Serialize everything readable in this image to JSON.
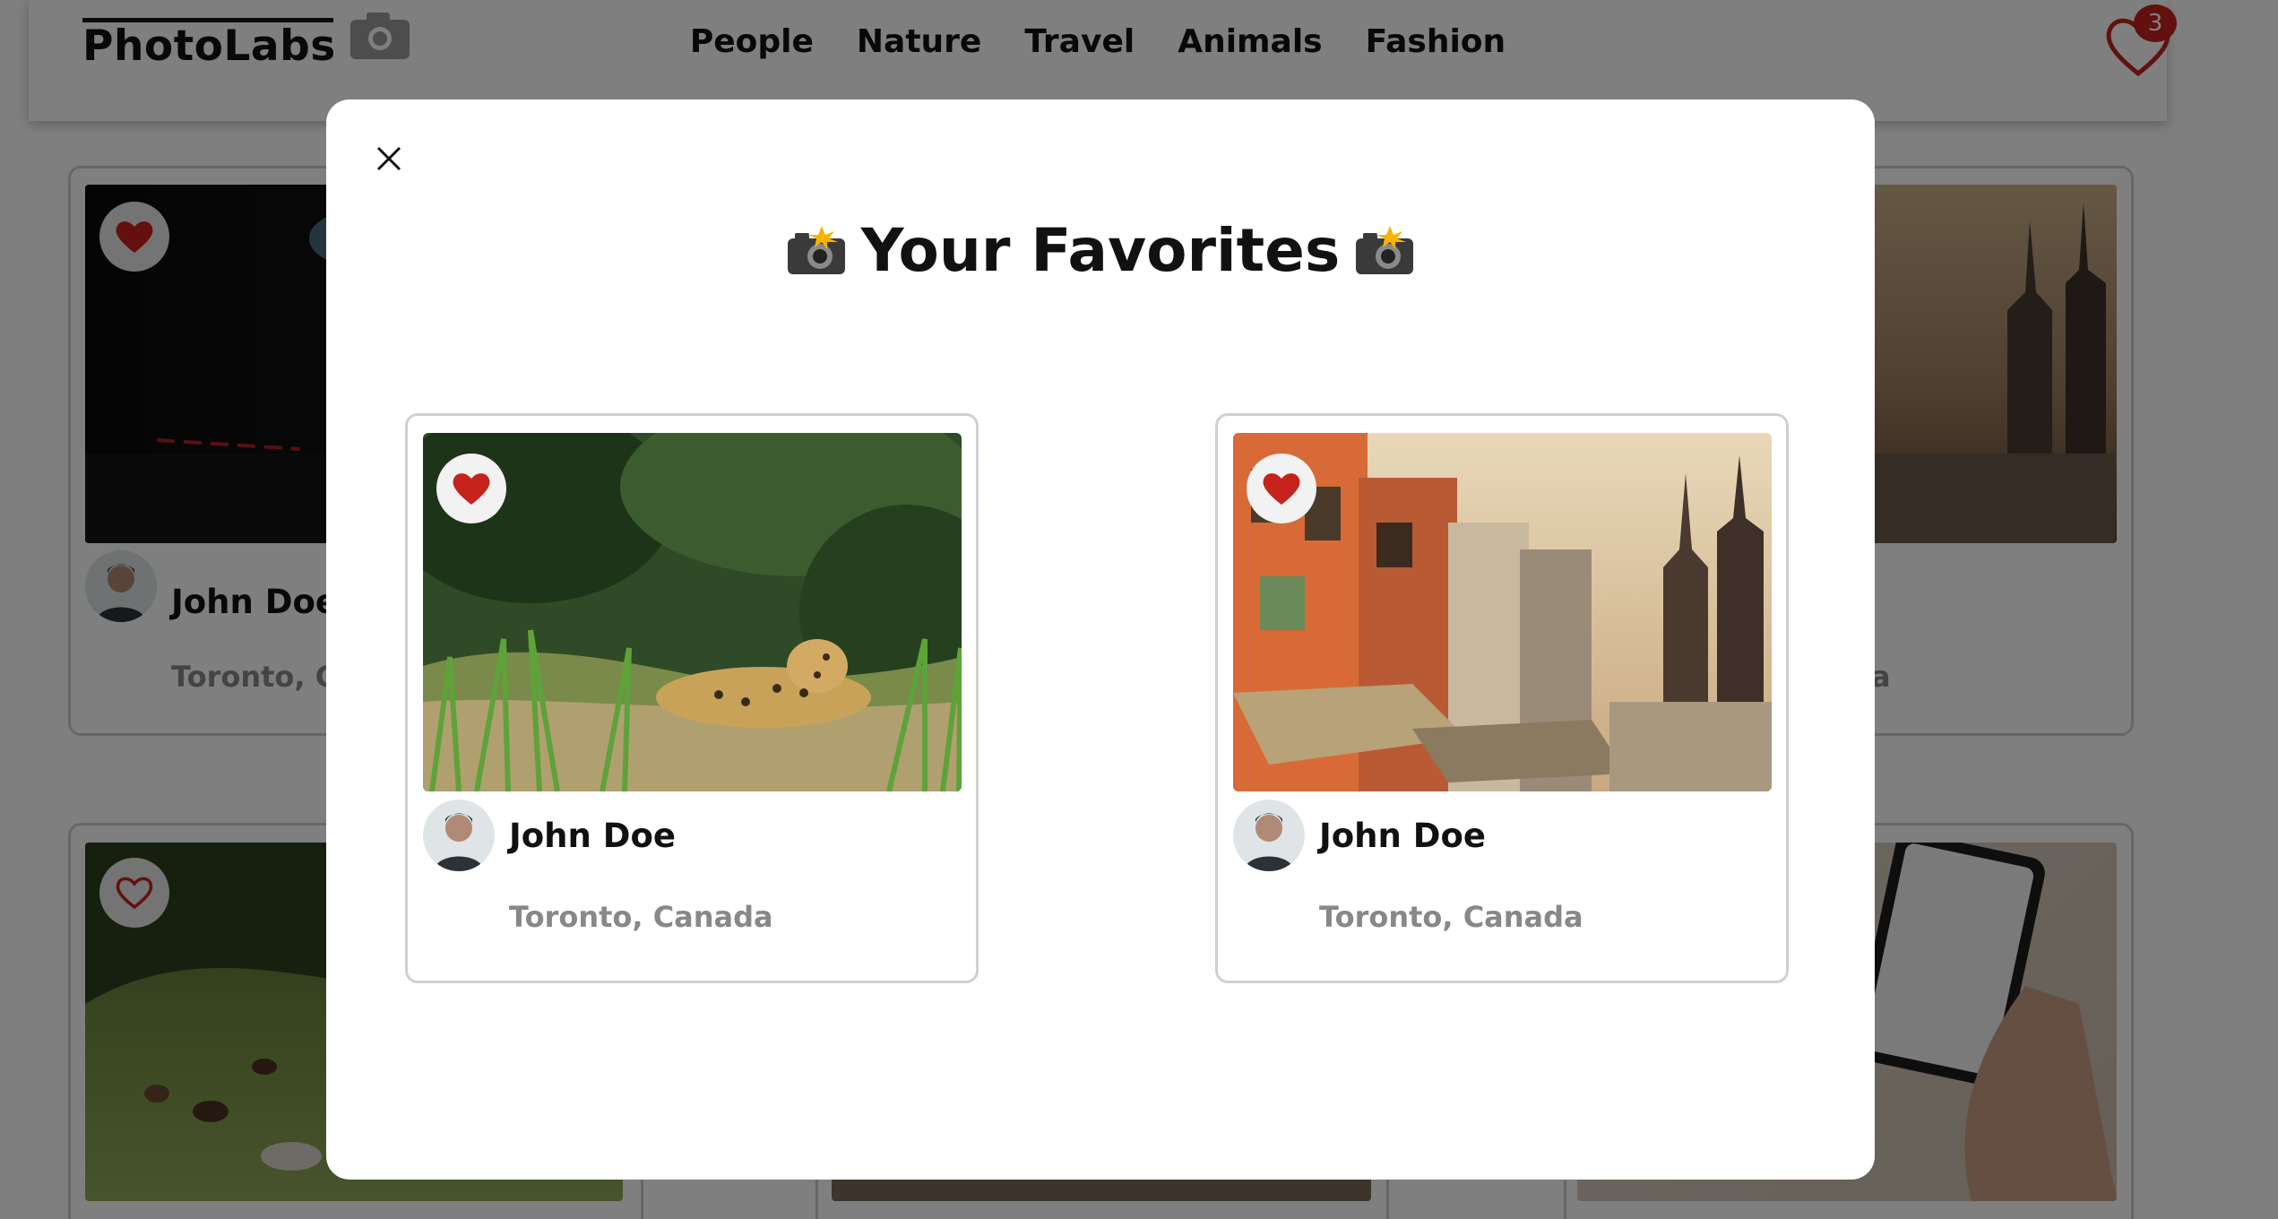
{
  "app": {
    "logo": "PhotoLabs"
  },
  "nav": {
    "topics": [
      "People",
      "Nature",
      "Travel",
      "Animals",
      "Fashion"
    ],
    "favorites_count": "3"
  },
  "background_cards": [
    {
      "name": "John Doe",
      "location": "Toronto, Ca",
      "liked": true
    },
    {
      "location_tail": "a",
      "liked": false
    },
    {
      "liked": false
    }
  ],
  "modal": {
    "title": "Your Favorites",
    "favorites": [
      {
        "name": "John Doe",
        "location": "Toronto, Canada",
        "liked": true,
        "photo": "jaguar-in-grass"
      },
      {
        "name": "John Doe",
        "location": "Toronto, Canada",
        "liked": true,
        "photo": "city-street-temples"
      }
    ]
  },
  "colors": {
    "accent_red": "#c5231c",
    "muted_text": "#888888",
    "overlay": "rgba(0,0,0,0.5)"
  }
}
